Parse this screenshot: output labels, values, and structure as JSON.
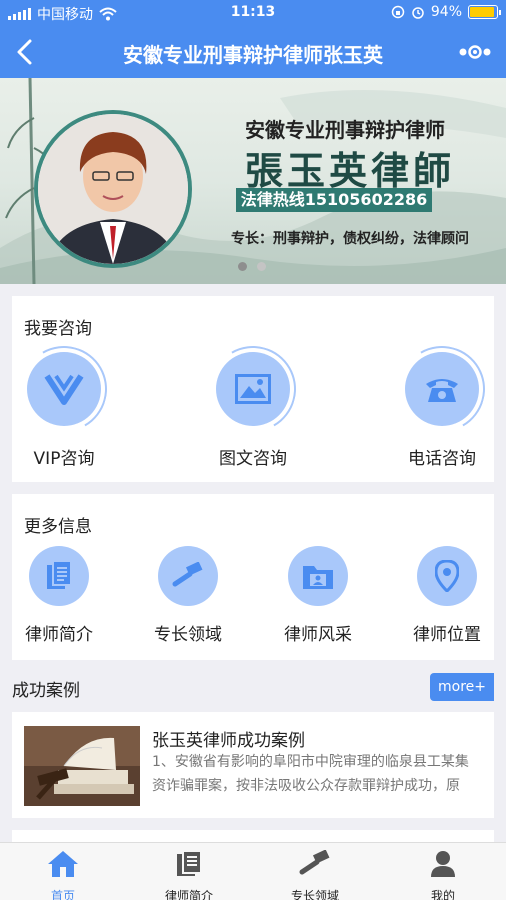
{
  "status_bar": {
    "carrier": "中国移动",
    "time": "11:13",
    "battery": "94%",
    "battery_level": 0.94
  },
  "nav": {
    "title": "安徽专业刑事辩护律师张玉英"
  },
  "banner": {
    "subtitle": "安徽专业刑事辩护律师",
    "name": "張玉英律師",
    "hotline": "法律热线15105602286",
    "specialty": "专长：刑事辩护，债权纠纷，法律顾问"
  },
  "consult": {
    "title": "我要咨询",
    "items": [
      {
        "label": "VIP咨询",
        "icon": "vip-icon"
      },
      {
        "label": "图文咨询",
        "icon": "picture-icon"
      },
      {
        "label": "电话咨询",
        "icon": "phone-icon"
      }
    ]
  },
  "more_info": {
    "title": "更多信息",
    "items": [
      {
        "label": "律师简介",
        "icon": "document-icon"
      },
      {
        "label": "专长领域",
        "icon": "gavel-icon"
      },
      {
        "label": "律师风采",
        "icon": "folder-icon"
      },
      {
        "label": "律师位置",
        "icon": "location-icon"
      }
    ]
  },
  "success": {
    "title": "成功案例",
    "more": "more+",
    "cases": [
      {
        "title": "张玉英律师成功案例",
        "desc": "1、安徽省有影响的阜阳市中院审理的临泉县工某集资诈骗罪案，按非法吸收公众存款罪辩护成功，原"
      }
    ]
  },
  "tabs": [
    {
      "label": "首页",
      "icon": "home-icon",
      "active": true
    },
    {
      "label": "律师简介",
      "icon": "document-icon"
    },
    {
      "label": "专长领域",
      "icon": "gavel-icon"
    },
    {
      "label": "我的",
      "icon": "user-icon"
    }
  ],
  "colors": {
    "primary": "#4a8cf0",
    "icon_circle": "#a9c8fa",
    "icon_glyph": "#4a8cf0",
    "banner_accent": "#2f7a72"
  }
}
